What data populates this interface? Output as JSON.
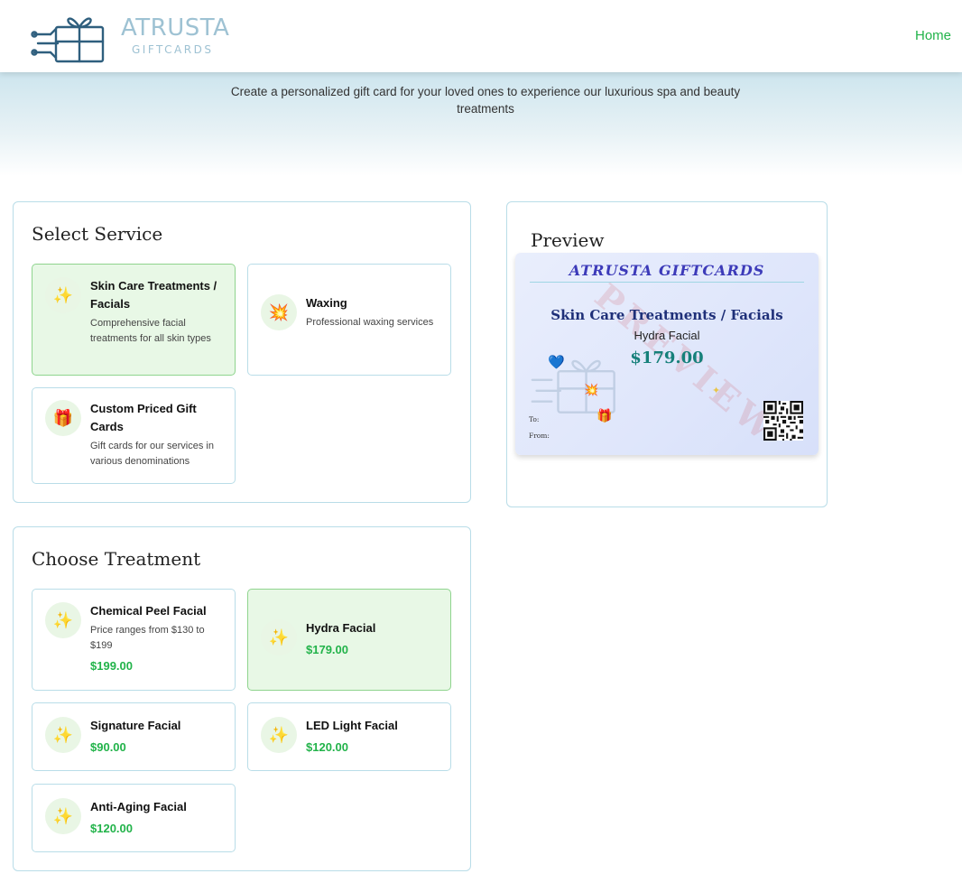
{
  "header": {
    "brand_name": "ATRUSTA",
    "brand_sub": "GIFTCARDS",
    "nav_home": "Home"
  },
  "hero": {
    "tagline": "Create a personalized gift card for your loved ones to experience our luxurious spa and beauty treatments"
  },
  "select_service": {
    "title": "Select Service",
    "options": [
      {
        "icon": "sparkles-icon",
        "title": "Skin Care Treatments / Facials",
        "desc": "Comprehensive facial treatments for all skin types",
        "selected": true
      },
      {
        "icon": "starburst-icon",
        "title": "Waxing",
        "desc": "Professional waxing services",
        "selected": false
      },
      {
        "icon": "gift-icon",
        "title": "Custom Priced Gift Cards",
        "desc": "Gift cards for our services in various denominations",
        "selected": false
      }
    ]
  },
  "choose_treatment": {
    "title": "Choose Treatment",
    "options": [
      {
        "icon": "sparkles-icon",
        "title": "Chemical Peel Facial",
        "desc": "Price ranges from $130 to $199",
        "price": "$199.00",
        "selected": false
      },
      {
        "icon": "sparkles-icon",
        "title": "Hydra Facial",
        "price": "$179.00",
        "selected": true
      },
      {
        "icon": "sparkles-icon",
        "title": "Signature Facial",
        "price": "$90.00",
        "selected": false
      },
      {
        "icon": "sparkles-icon",
        "title": "LED Light Facial",
        "price": "$120.00",
        "selected": false
      },
      {
        "icon": "sparkles-icon",
        "title": "Anti-Aging Facial",
        "price": "$120.00",
        "selected": false
      }
    ]
  },
  "preview": {
    "title": "Preview",
    "card": {
      "brand": "ATRUSTA GIFTCARDS",
      "service": "Skin Care Treatments / Facials",
      "treatment": "Hydra Facial",
      "price": "$179.00",
      "to_label": "To:",
      "from_label": "From:",
      "stamp": "PREVIEW"
    }
  },
  "colors": {
    "accent_green": "#22b34a",
    "selected_bg": "#e8f8e6",
    "border": "#b9dde8",
    "brand": "#9ec2d3",
    "card_brand": "#3c3ab9"
  }
}
